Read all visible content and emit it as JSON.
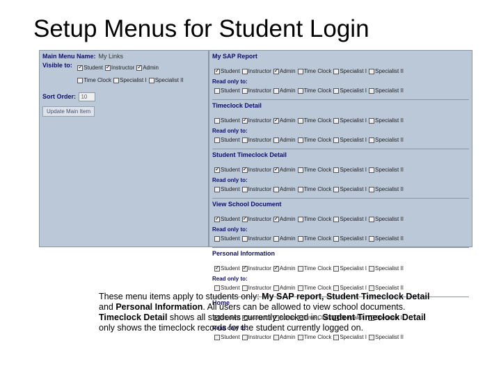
{
  "title": "Setup Menus for Student Login",
  "left": {
    "main_menu_label": "Main Menu Name:",
    "main_menu_value": "My Links",
    "visible_to_label": "Visible to:",
    "sort_order_label": "Sort Order:",
    "sort_order_value": "10",
    "button_label": "Update Main Item"
  },
  "roles": [
    "Student",
    "Instructor",
    "Admin",
    "Time Clock",
    "Specialist I",
    "Specialist II"
  ],
  "read_only_label": "Read only to:",
  "sections": [
    {
      "name": "My SAP Report",
      "vis": [
        1,
        0,
        1,
        0,
        0,
        0
      ],
      "ro": [
        0,
        0,
        0,
        0,
        0,
        0
      ]
    },
    {
      "name": "Timeclock Detail",
      "vis": [
        0,
        1,
        1,
        0,
        0,
        0
      ],
      "ro": [
        0,
        0,
        0,
        0,
        0,
        0
      ]
    },
    {
      "name": "Student Timeclock Detail",
      "vis": [
        1,
        1,
        1,
        0,
        0,
        0
      ],
      "ro": [
        0,
        0,
        0,
        0,
        0,
        0
      ]
    },
    {
      "name": "View School Document",
      "vis": [
        1,
        1,
        1,
        0,
        0,
        0
      ],
      "ro": [
        0,
        0,
        0,
        0,
        0,
        0
      ]
    },
    {
      "name": "Personal Information",
      "vis": [
        1,
        1,
        1,
        0,
        0,
        0
      ],
      "ro": [
        0,
        0,
        0,
        0,
        0,
        0
      ]
    },
    {
      "name": "Home",
      "vis": [
        1,
        1,
        1,
        0,
        0,
        0
      ],
      "ro": [
        0,
        0,
        0,
        0,
        0,
        0
      ]
    }
  ],
  "left_vis": [
    1,
    1,
    1,
    0,
    0,
    0
  ],
  "desc_parts": [
    "These menu items apply to students only: ",
    "My SAP report, Student Timeclock Detail",
    " and ",
    "Personal Information",
    ". All users can be allowed to view school documents. ",
    "Timeclock Detail",
    " shows all students currently clocked in. ",
    "Student Timeclock Detail",
    " only shows the timeclock records for the student currently logged on."
  ]
}
